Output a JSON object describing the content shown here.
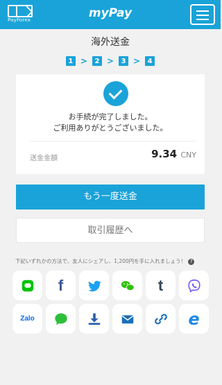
{
  "header": {
    "logo_text": "PayForex",
    "app_title": "myPay",
    "menu_icon": "hamburger-menu-icon",
    "brand_color": "#1aa3d8"
  },
  "page": {
    "title": "海外送金"
  },
  "steps": {
    "items": [
      "1",
      "2",
      "3",
      "4"
    ],
    "separator": ">",
    "current_step": "4"
  },
  "result": {
    "icon": "check-icon",
    "message_line1": "お手続が完了しました。",
    "message_line2": "ご利用ありがとうございました。",
    "amount_label": "送金金額",
    "amount_value": "9.34",
    "amount_currency": "CNY"
  },
  "actions": {
    "primary_label": "もう一度送金",
    "secondary_label": "取引履歴へ"
  },
  "share": {
    "note": "下記いずれかの方法で、友人にシェアし、1,200円を手に入れましょう！",
    "help_icon": "?",
    "row1": [
      "line",
      "facebook",
      "twitter",
      "wechat",
      "tumblr",
      "viber"
    ],
    "row2": [
      "zalo",
      "sms",
      "download",
      "email",
      "copy-link",
      "ie"
    ],
    "row1_text": {
      "f": "f",
      "t": "t"
    },
    "row2_text": {
      "zalo": "Zalo",
      "sms": "SMS",
      "e": "e"
    }
  }
}
